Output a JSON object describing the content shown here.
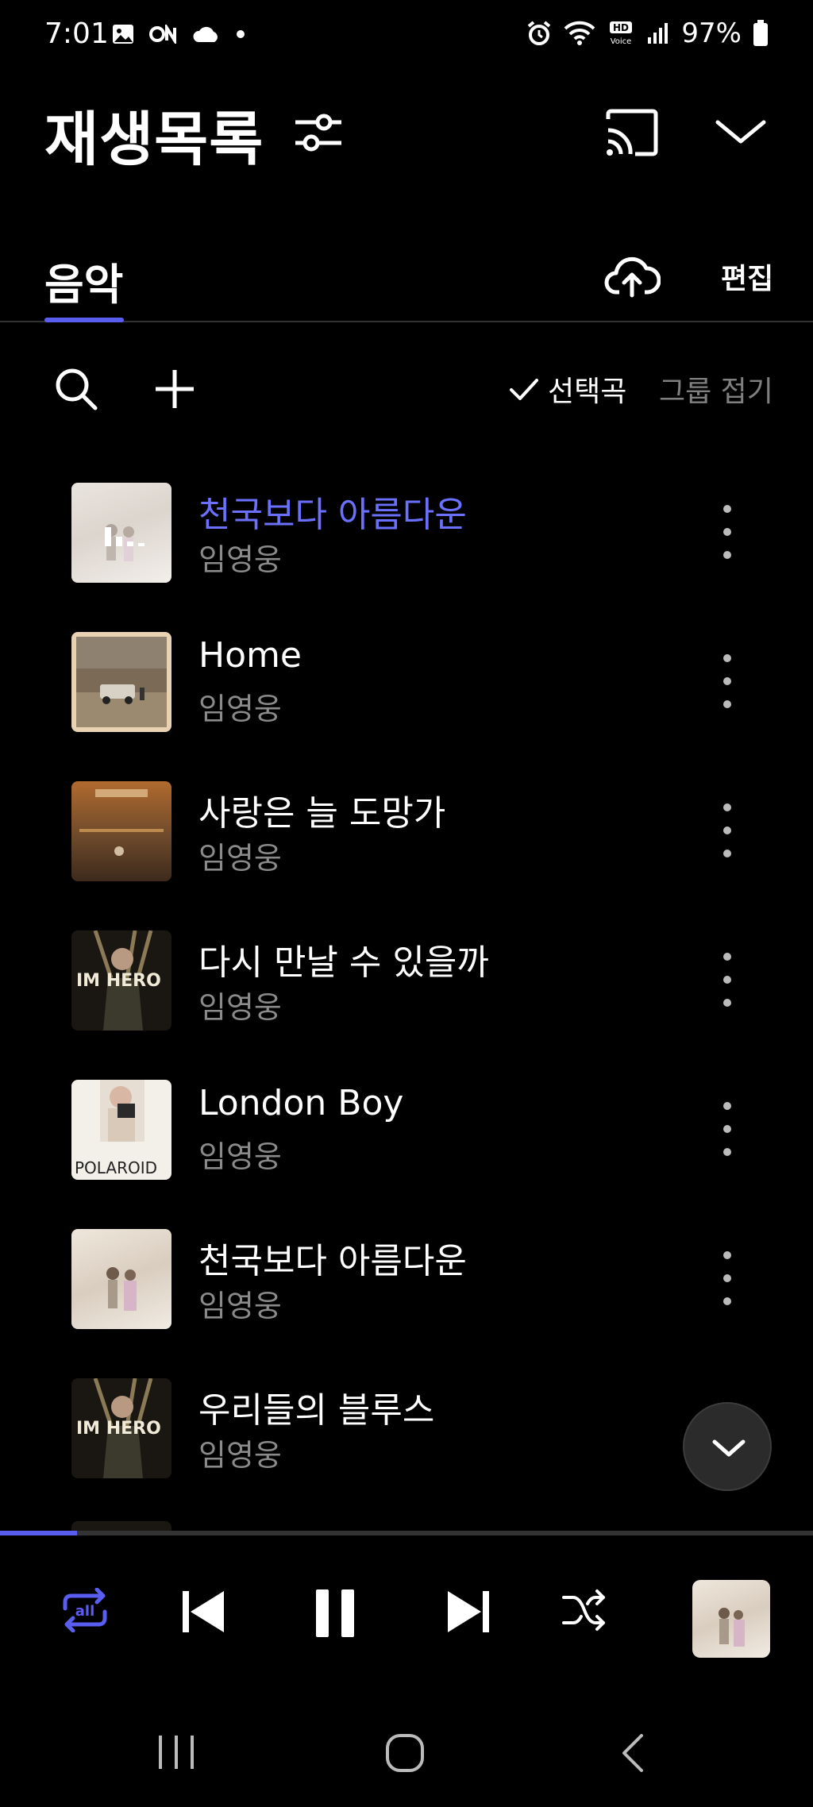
{
  "status_bar": {
    "time": "7:01",
    "battery": "97%",
    "left_icons": [
      "gallery-icon",
      "on-icon",
      "cloud-icon",
      "dot-icon"
    ],
    "right_icons": [
      "alarm-icon",
      "wifi-icon",
      "hd-voice-icon",
      "signal-icon",
      "battery-icon"
    ]
  },
  "header": {
    "title": "재생목록",
    "icons": [
      "filter-icon",
      "cast-icon",
      "chevron-down-icon"
    ]
  },
  "tabs": {
    "active": "음악",
    "edit_label": "편집",
    "upload_icon": "cloud-upload-icon"
  },
  "toolbar": {
    "selected_label": "선택곡",
    "collapse_label": "그룹 접기"
  },
  "songs": [
    {
      "title": "천국보다 아름다운",
      "artist": "임영웅",
      "playing": true
    },
    {
      "title": "Home",
      "artist": "임영웅",
      "playing": false
    },
    {
      "title": "사랑은 늘 도망가",
      "artist": "임영웅",
      "playing": false
    },
    {
      "title": "다시 만날 수 있을까",
      "artist": "임영웅",
      "playing": false
    },
    {
      "title": "London Boy",
      "artist": "임영웅",
      "playing": false
    },
    {
      "title": "천국보다 아름다운",
      "artist": "임영웅",
      "playing": false
    },
    {
      "title": "우리들의 블루스",
      "artist": "임영웅",
      "playing": false
    }
  ],
  "album_art_text": {
    "im_hero": "IM HERO",
    "polaroid": "POLAROID"
  },
  "player": {
    "repeat_label": "all",
    "progress_fraction": 0.095
  },
  "colors": {
    "accent": "#5a5ef0",
    "playing_title": "#6b70ff",
    "background": "#000000",
    "secondary_text": "#8a8a8a"
  }
}
